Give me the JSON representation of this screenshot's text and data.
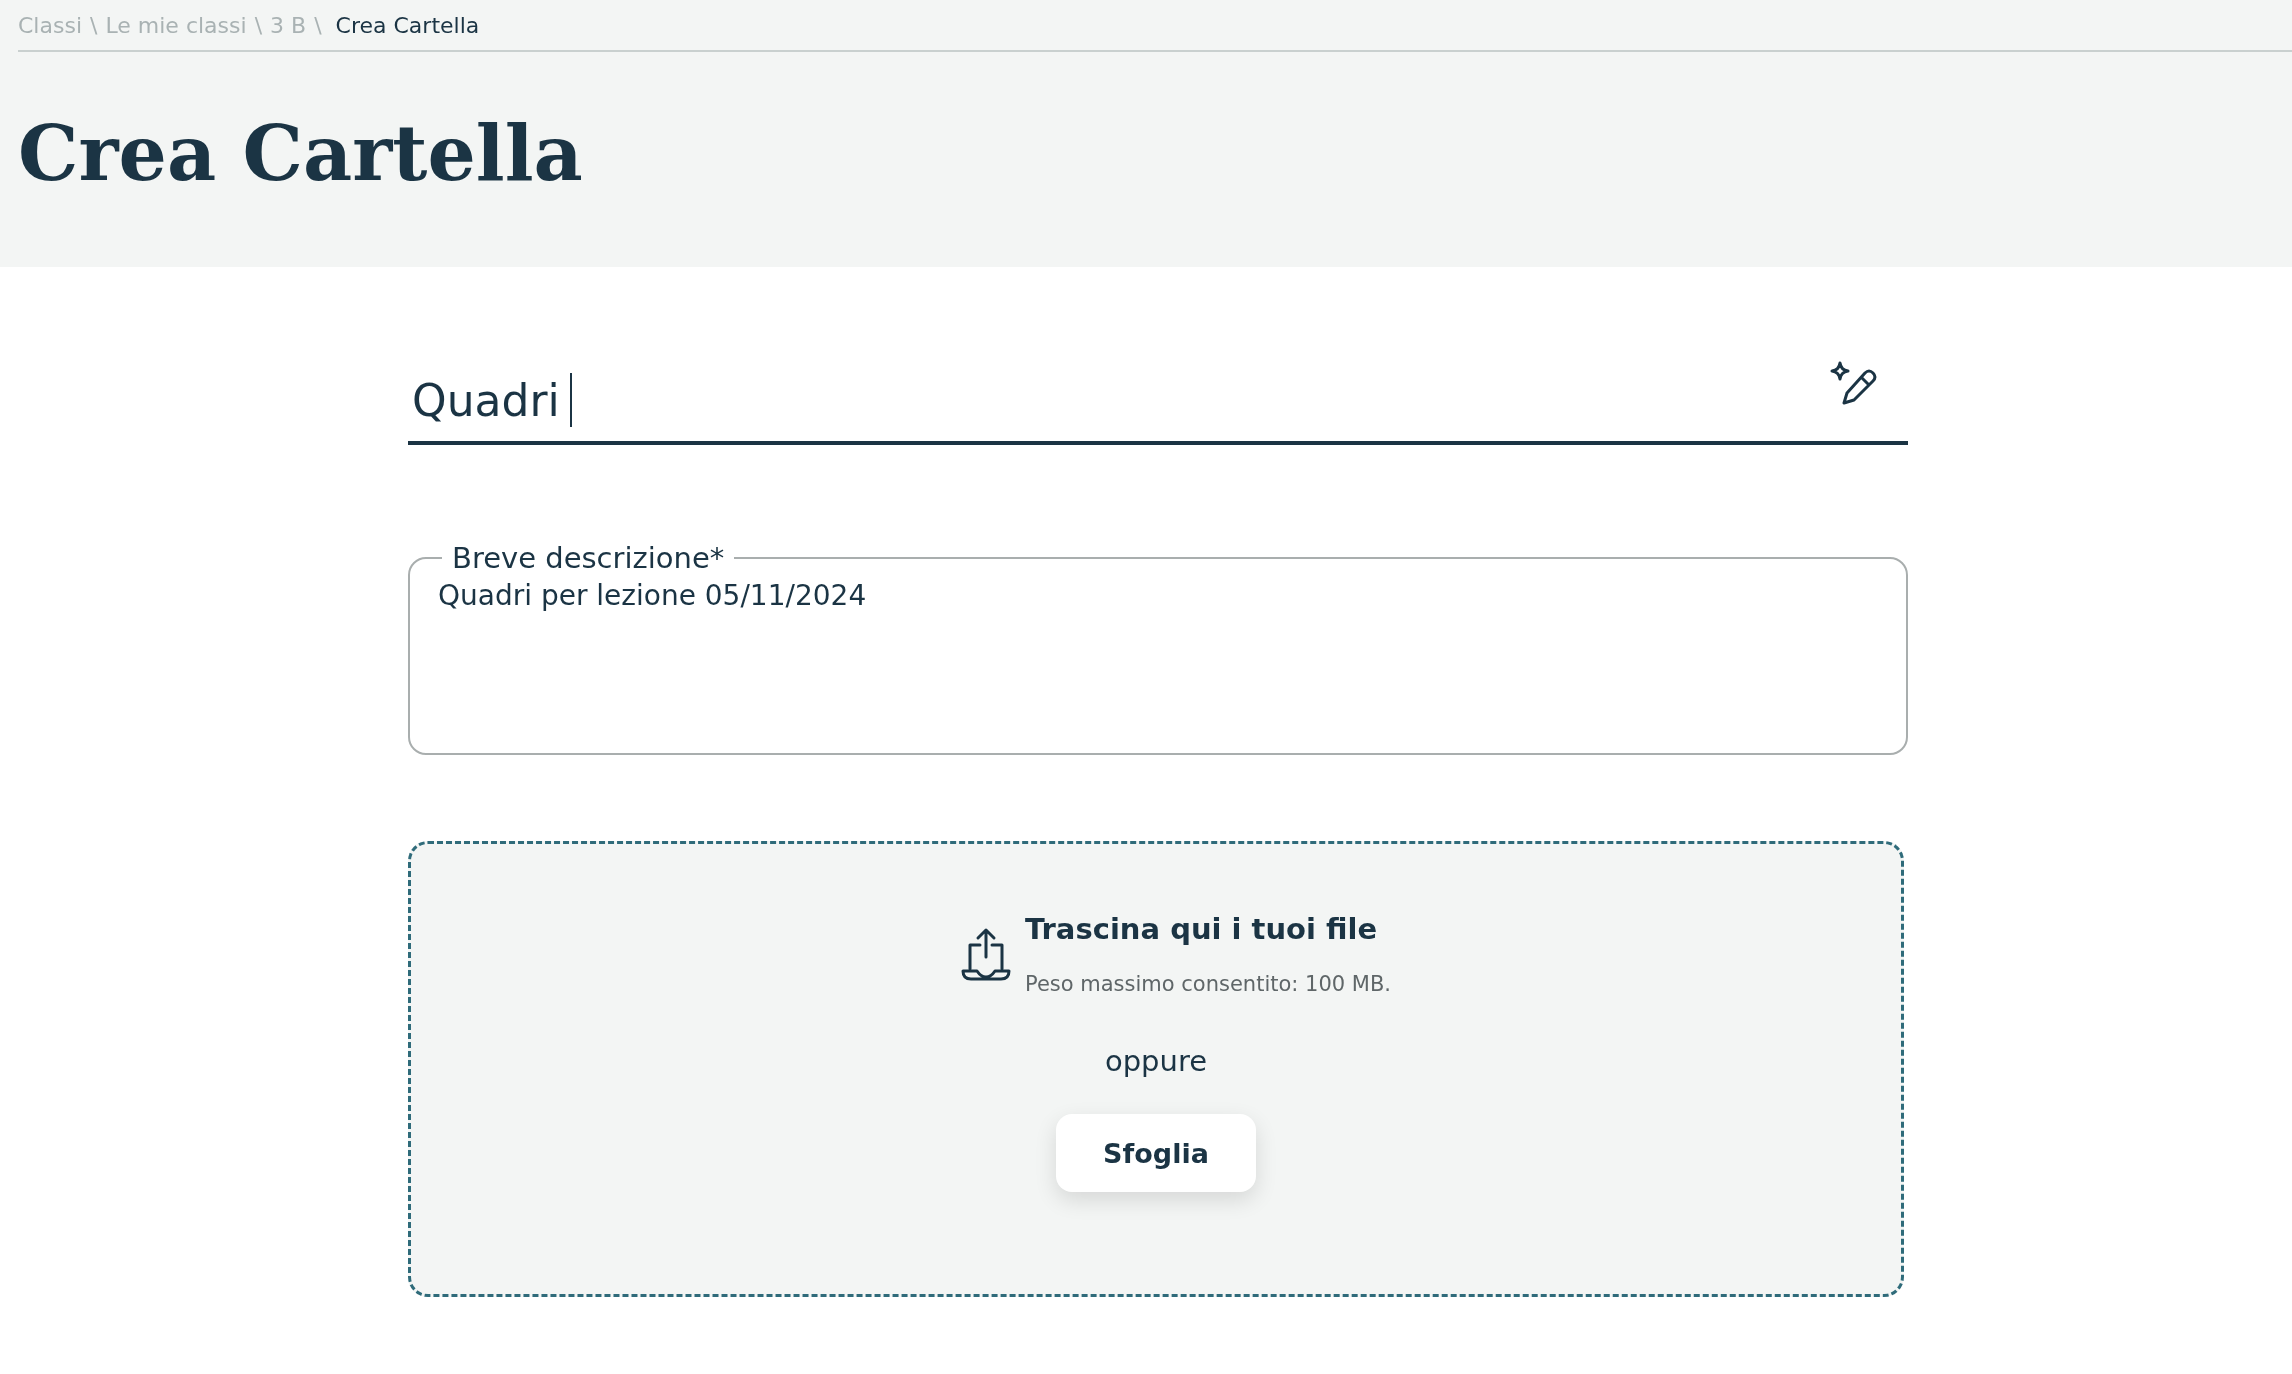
{
  "breadcrumb": [
    {
      "label": "Classi",
      "separator": "\\",
      "current": false
    },
    {
      "label": "Le mie classi",
      "separator": "\\",
      "current": false
    },
    {
      "label": "3 B",
      "separator": "\\",
      "current": false
    },
    {
      "label": "Crea Cartella",
      "current": true
    }
  ],
  "page_title": "Crea Cartella",
  "name_field": {
    "value": "Quadri"
  },
  "description_field": {
    "label": "Breve descrizione*",
    "value": "Quadri per lezione 05/11/2024"
  },
  "dropzone": {
    "heading": "Trascina qui i tuoi file",
    "hint": "Peso massimo consentito: 100 MB.",
    "separator_text": "oppure",
    "button": "Sfoglia"
  }
}
